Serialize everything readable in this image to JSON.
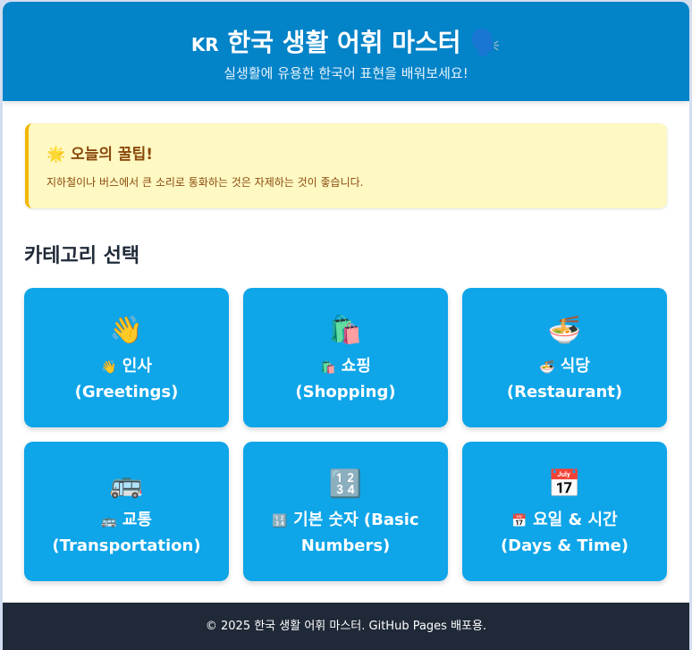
{
  "header": {
    "flag": "KR",
    "title": "한국 생활 어휘 마스터",
    "title_icon": "🗣️",
    "subtitle": "실생활에 유용한 한국어 표현을 배워보세요!"
  },
  "tip": {
    "icon": "🌟",
    "title": "오늘의 꿀팁!",
    "text": "지하철이나 버스에서 큰 소리로 통화하는 것은 자제하는 것이 좋습니다."
  },
  "categories_title": "카테고리 선택",
  "categories": [
    {
      "icon": "👋",
      "name": "인사",
      "english": "(Greetings)"
    },
    {
      "icon": "🛍️",
      "name": "쇼핑",
      "english": "(Shopping)"
    },
    {
      "icon": "🍜",
      "name": "식당",
      "english": "(Restaurant)"
    },
    {
      "icon": "🚌",
      "name": "교통",
      "english": "(Transportation)"
    },
    {
      "icon": "🔢",
      "name": "기본 숫자 (Basic",
      "english": "Numbers)"
    },
    {
      "icon": "📅",
      "name": "요일 & 시간",
      "english": "(Days & Time)"
    }
  ],
  "footer": "© 2025 한국 생활 어휘 마스터. GitHub Pages 배포용."
}
